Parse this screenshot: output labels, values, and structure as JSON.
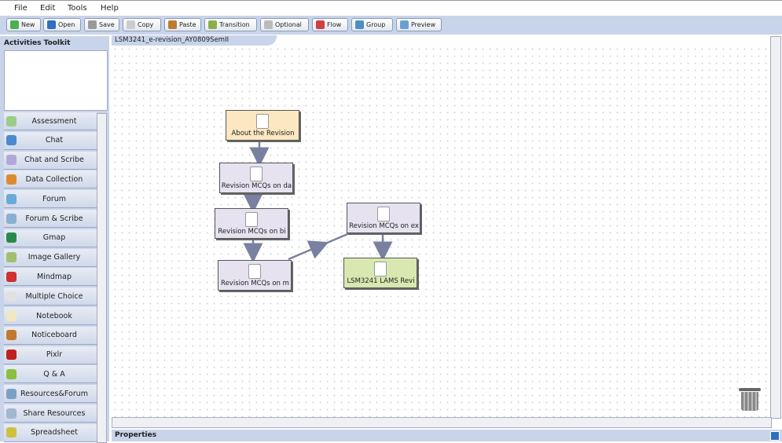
{
  "menu": [
    "File",
    "Edit",
    "Tools",
    "Help"
  ],
  "toolbar": [
    {
      "label": "New",
      "icon": "new-icon",
      "color": "#4caf50"
    },
    {
      "label": "Open",
      "icon": "open-folder-icon",
      "color": "#2f6fc0"
    },
    {
      "label": "Save",
      "icon": "save-icon",
      "color": "#999999"
    },
    {
      "label": "Copy",
      "icon": "copy-icon",
      "color": "#cccccc"
    },
    {
      "label": "Paste",
      "icon": "paste-icon",
      "color": "#c07a30"
    },
    {
      "label": "Transition",
      "icon": "pencil-icon",
      "color": "#8ab04a"
    },
    {
      "label": "Optional",
      "icon": "pencil-gray-icon",
      "color": "#bbbbbb"
    },
    {
      "label": "Flow",
      "icon": "flow-icon",
      "color": "#d04040"
    },
    {
      "label": "Group",
      "icon": "group-icon",
      "color": "#4a90c0"
    },
    {
      "label": "Preview",
      "icon": "magnifier-icon",
      "color": "#6aa0d0"
    }
  ],
  "toolkit": {
    "title": "Activities Toolkit",
    "items": [
      {
        "label": "Assessment",
        "color": "#9ccc8a"
      },
      {
        "label": "Chat",
        "color": "#4a8ad0"
      },
      {
        "label": "Chat and Scribe",
        "color": "#b0a8d8"
      },
      {
        "label": "Data Collection",
        "color": "#e08a30"
      },
      {
        "label": "Forum",
        "color": "#6aaad8"
      },
      {
        "label": "Forum & Scribe",
        "color": "#8ab0d0"
      },
      {
        "label": "Gmap",
        "color": "#2a8a4a"
      },
      {
        "label": "Image Gallery",
        "color": "#a0c070"
      },
      {
        "label": "Mindmap",
        "color": "#d03030"
      },
      {
        "label": "Multiple Choice",
        "color": "#e0e0e0"
      },
      {
        "label": "Notebook",
        "color": "#f0e8c0"
      },
      {
        "label": "Noticeboard",
        "color": "#c07a30"
      },
      {
        "label": "Pixlr",
        "color": "#c02020"
      },
      {
        "label": "Q & A",
        "color": "#8ac040"
      },
      {
        "label": "Resources&Forum",
        "color": "#7aa0c8"
      },
      {
        "label": "Share Resources",
        "color": "#a0b8d0"
      },
      {
        "label": "Spreadsheet",
        "color": "#d0c040"
      }
    ]
  },
  "tab": "LSM3241_e-revision_AY0809SemII",
  "nodes": [
    {
      "label": "About the Revision",
      "fill": "#fbe7c0"
    },
    {
      "label": "Revision MCQs on da",
      "fill": "#e6e2f0"
    },
    {
      "label": "Revision MCQs on bi",
      "fill": "#e6e2f0"
    },
    {
      "label": "Revision MCQs on m",
      "fill": "#e6e2f0"
    },
    {
      "label": "Revision MCQs on ex",
      "fill": "#e6e2f0"
    },
    {
      "label": "LSM3241 LAMS Revi",
      "fill": "#d8e8b0"
    }
  ],
  "properties": "Properties"
}
